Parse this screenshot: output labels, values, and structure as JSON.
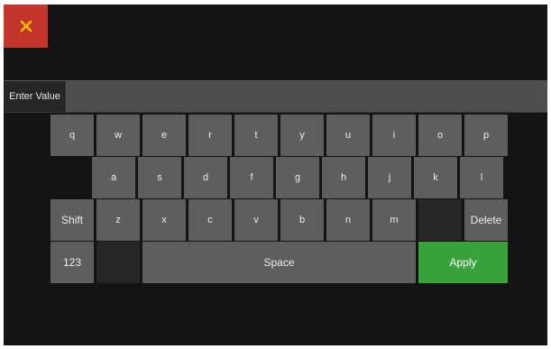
{
  "close_button": {
    "icon": "close-icon",
    "color": "#f5c400",
    "background": "#c4352c"
  },
  "input": {
    "label": "Enter Value",
    "value": ""
  },
  "keyboard": {
    "row1": [
      "q",
      "w",
      "e",
      "r",
      "t",
      "y",
      "u",
      "i",
      "o",
      "p"
    ],
    "row2": [
      "a",
      "s",
      "d",
      "f",
      "g",
      "h",
      "j",
      "k",
      "l"
    ],
    "row3_letters": [
      "z",
      "x",
      "c",
      "v",
      "b",
      "n",
      "m"
    ],
    "shift_label": "Shift",
    "delete_label": "Delete",
    "numbers_label": "123",
    "space_label": "Space",
    "apply_label": "Apply"
  },
  "colors": {
    "apply": "#3aa23c",
    "key": "#5e5e5e",
    "background": "#141414"
  }
}
